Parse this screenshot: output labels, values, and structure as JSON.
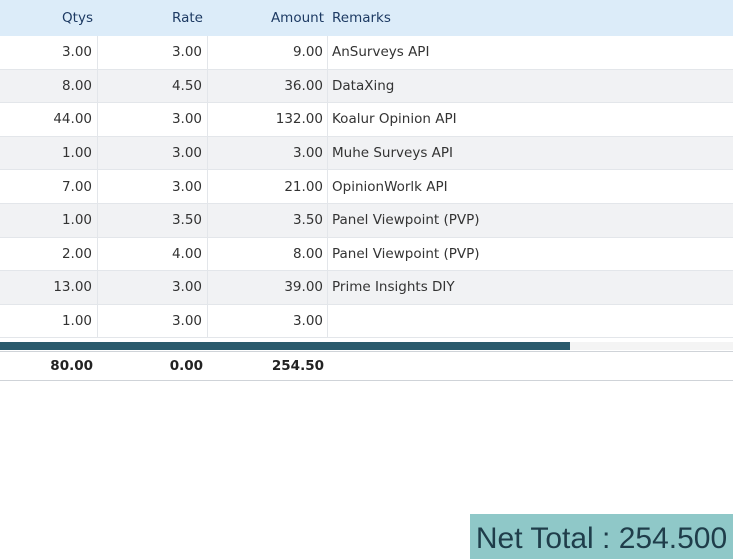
{
  "columns": {
    "qty": "Qtys",
    "rate": "Rate",
    "amount": "Amount",
    "remarks": "Remarks"
  },
  "rows": [
    {
      "qty": "3.00",
      "rate": "3.00",
      "amount": "9.00",
      "remarks": "AnSurveys API"
    },
    {
      "qty": "8.00",
      "rate": "4.50",
      "amount": "36.00",
      "remarks": "DataXing"
    },
    {
      "qty": "44.00",
      "rate": "3.00",
      "amount": "132.00",
      "remarks": "Koalur Opinion API"
    },
    {
      "qty": "1.00",
      "rate": "3.00",
      "amount": "3.00",
      "remarks": "Muhe Surveys API"
    },
    {
      "qty": "7.00",
      "rate": "3.00",
      "amount": "21.00",
      "remarks": "OpinionWorlk API"
    },
    {
      "qty": "1.00",
      "rate": "3.50",
      "amount": "3.50",
      "remarks": "Panel Viewpoint (PVP)"
    },
    {
      "qty": "2.00",
      "rate": "4.00",
      "amount": "8.00",
      "remarks": "Panel Viewpoint (PVP)"
    },
    {
      "qty": "13.00",
      "rate": "3.00",
      "amount": "39.00",
      "remarks": "Prime Insights DIY"
    },
    {
      "qty": "1.00",
      "rate": "3.00",
      "amount": "3.00",
      "remarks": ""
    }
  ],
  "totals": {
    "qty": "80.00",
    "rate": "0.00",
    "amount": "254.50"
  },
  "net_total": "Net Total : 254.500",
  "colors": {
    "header_bg": "#dcecf9",
    "scrollbar_thumb": "#2a5a6c",
    "net_total_bg": "#8fc8c8"
  }
}
